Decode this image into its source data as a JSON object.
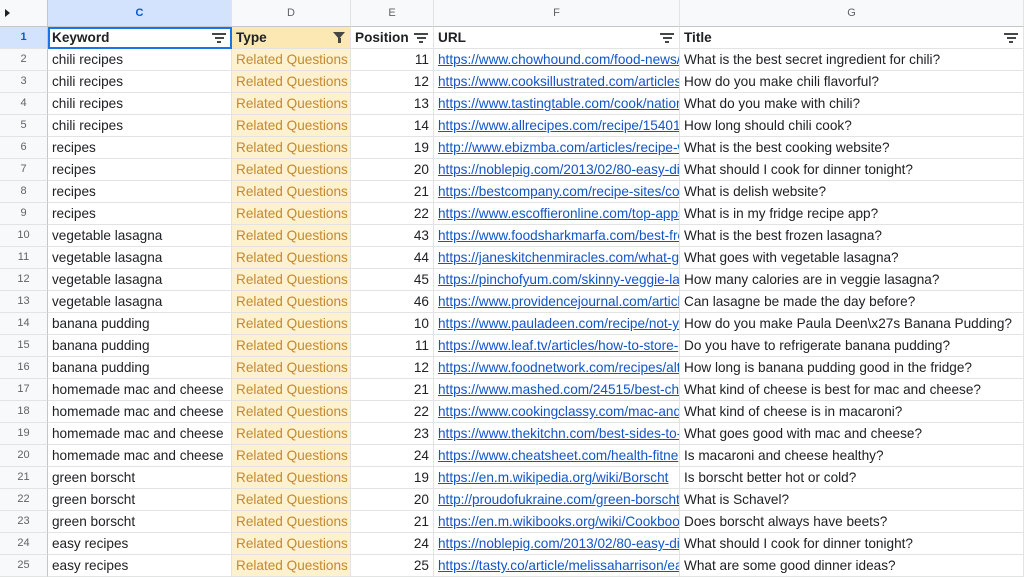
{
  "column_letters": [
    "C",
    "D",
    "E",
    "F",
    "G"
  ],
  "headers": {
    "keyword": "Keyword",
    "type": "Type",
    "position": "Position",
    "url": "URL",
    "title": "Title"
  },
  "header_row_number": "1",
  "rows": [
    {
      "n": "2",
      "keyword": "chili recipes",
      "type": "Related Questions",
      "position": "11",
      "url": "https://www.chowhound.com/food-news/",
      "title": "What is the best secret ingredient for chili?"
    },
    {
      "n": "3",
      "keyword": "chili recipes",
      "type": "Related Questions",
      "position": "12",
      "url": "https://www.cooksillustrated.com/articles",
      "title": "How do you make chili flavorful?"
    },
    {
      "n": "4",
      "keyword": "chili recipes",
      "type": "Related Questions",
      "position": "13",
      "url": "https://www.tastingtable.com/cook/nation",
      "title": "What do you make with chili?"
    },
    {
      "n": "5",
      "keyword": "chili recipes",
      "type": "Related Questions",
      "position": "14",
      "url": "https://www.allrecipes.com/recipe/15401",
      "title": "How long should chili cook?"
    },
    {
      "n": "6",
      "keyword": "recipes",
      "type": "Related Questions",
      "position": "19",
      "url": "http://www.ebizmba.com/articles/recipe-w",
      "title": "What is the best cooking website?"
    },
    {
      "n": "7",
      "keyword": "recipes",
      "type": "Related Questions",
      "position": "20",
      "url": "https://noblepig.com/2013/02/80-easy-di",
      "title": "What should I cook for dinner tonight?"
    },
    {
      "n": "8",
      "keyword": "recipes",
      "type": "Related Questions",
      "position": "21",
      "url": "https://bestcompany.com/recipe-sites/co",
      "title": "What is delish website?"
    },
    {
      "n": "9",
      "keyword": "recipes",
      "type": "Related Questions",
      "position": "22",
      "url": "https://www.escoffieronline.com/top-apps",
      "title": "What is in my fridge recipe app?"
    },
    {
      "n": "10",
      "keyword": "vegetable lasagna",
      "type": "Related Questions",
      "position": "43",
      "url": "https://www.foodsharkmarfa.com/best-fro",
      "title": "What is the best frozen lasagna?"
    },
    {
      "n": "11",
      "keyword": "vegetable lasagna",
      "type": "Related Questions",
      "position": "44",
      "url": "https://janeskitchenmiracles.com/what-g",
      "title": "What goes with vegetable lasagna?"
    },
    {
      "n": "12",
      "keyword": "vegetable lasagna",
      "type": "Related Questions",
      "position": "45",
      "url": "https://pinchofyum.com/skinny-veggie-la",
      "title": "How many calories are in veggie lasagna?"
    },
    {
      "n": "13",
      "keyword": "vegetable lasagna",
      "type": "Related Questions",
      "position": "46",
      "url": "https://www.providencejournal.com/articl",
      "title": "Can lasagne be made the day before?"
    },
    {
      "n": "14",
      "keyword": "banana pudding",
      "type": "Related Questions",
      "position": "10",
      "url": "https://www.pauladeen.com/recipe/not-y",
      "title": "How do you make Paula Deen\\x27s Banana Pudding?"
    },
    {
      "n": "15",
      "keyword": "banana pudding",
      "type": "Related Questions",
      "position": "11",
      "url": "https://www.leaf.tv/articles/how-to-store-",
      "title": "Do you have to refrigerate banana pudding?"
    },
    {
      "n": "16",
      "keyword": "banana pudding",
      "type": "Related Questions",
      "position": "12",
      "url": "https://www.foodnetwork.com/recipes/alt",
      "title": "How long is banana pudding good in the fridge?"
    },
    {
      "n": "17",
      "keyword": "homemade mac and cheese",
      "type": "Related Questions",
      "position": "21",
      "url": "https://www.mashed.com/24515/best-ch",
      "title": "What kind of cheese is best for mac and cheese?"
    },
    {
      "n": "18",
      "keyword": "homemade mac and cheese",
      "type": "Related Questions",
      "position": "22",
      "url": "https://www.cookingclassy.com/mac-and",
      "title": "What kind of cheese is in macaroni?"
    },
    {
      "n": "19",
      "keyword": "homemade mac and cheese",
      "type": "Related Questions",
      "position": "23",
      "url": "https://www.thekitchn.com/best-sides-to-",
      "title": "What goes good with mac and cheese?"
    },
    {
      "n": "20",
      "keyword": "homemade mac and cheese",
      "type": "Related Questions",
      "position": "24",
      "url": "https://www.cheatsheet.com/health-fitne",
      "title": "Is macaroni and cheese healthy?"
    },
    {
      "n": "21",
      "keyword": "green borscht",
      "type": "Related Questions",
      "position": "19",
      "url": "https://en.m.wikipedia.org/wiki/Borscht",
      "title": "Is borscht better hot or cold?"
    },
    {
      "n": "22",
      "keyword": "green borscht",
      "type": "Related Questions",
      "position": "20",
      "url": "http://proudofukraine.com/green-borscht",
      "title": "What is Schavel?"
    },
    {
      "n": "23",
      "keyword": "green borscht",
      "type": "Related Questions",
      "position": "21",
      "url": "https://en.m.wikibooks.org/wiki/Cookboo",
      "title": "Does borscht always have beets?"
    },
    {
      "n": "24",
      "keyword": "easy recipes",
      "type": "Related Questions",
      "position": "24",
      "url": "https://noblepig.com/2013/02/80-easy-di",
      "title": "What should I cook for dinner tonight?"
    },
    {
      "n": "25",
      "keyword": "easy recipes",
      "type": "Related Questions",
      "position": "25",
      "url": "https://tasty.co/article/melissaharrison/ea",
      "title": "What are some good dinner ideas?"
    }
  ],
  "colors": {
    "selected_header": "#d3e3fd",
    "type_fill": "#fdf1cf",
    "type_header_fill": "#fce8b2",
    "link": "#1155cc",
    "active_border": "#1a73e8"
  },
  "icons": {
    "corner": "triangle-right-icon",
    "filter": "filter-lines-icon",
    "active_filter": "funnel-icon"
  }
}
